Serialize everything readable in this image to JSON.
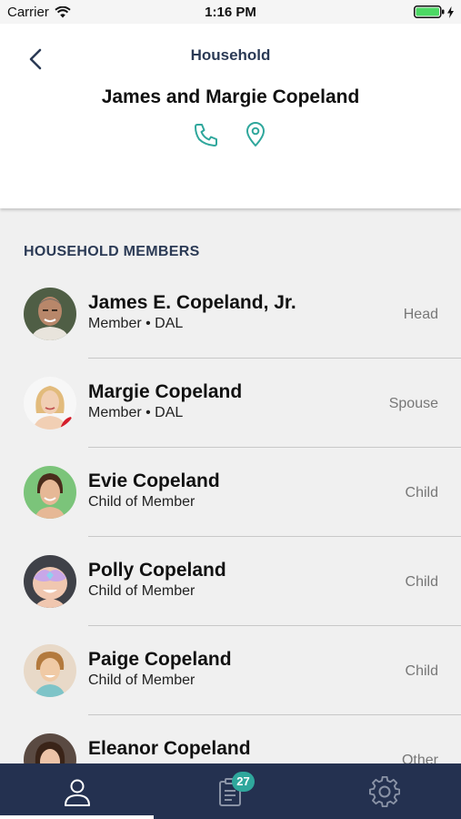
{
  "status_bar": {
    "carrier": "Carrier",
    "time": "1:16 PM"
  },
  "header": {
    "title": "Household",
    "household_name": "James and Margie Copeland"
  },
  "colors": {
    "accent": "#2fa79c",
    "navy": "#243150",
    "title": "#2b3a55"
  },
  "icons": {
    "back": "chevron-left-icon",
    "phone": "phone-icon",
    "location": "map-pin-icon"
  },
  "section": {
    "title": "HOUSEHOLD MEMBERS"
  },
  "members": [
    {
      "name": "James E. Copeland, Jr.",
      "subtitle": "Member • DAL",
      "role": "Head"
    },
    {
      "name": "Margie Copeland",
      "subtitle": "Member • DAL",
      "role": "Spouse"
    },
    {
      "name": "Evie Copeland",
      "subtitle": "Child of Member",
      "role": "Child"
    },
    {
      "name": "Polly Copeland",
      "subtitle": "Child of Member",
      "role": "Child"
    },
    {
      "name": "Paige Copeland",
      "subtitle": "Child of Member",
      "role": "Child"
    },
    {
      "name": "Eleanor Copeland",
      "subtitle": "",
      "role": "Other"
    }
  ],
  "tabs": [
    {
      "icon": "person-icon",
      "active": true
    },
    {
      "icon": "clipboard-icon",
      "badge": "27"
    },
    {
      "icon": "gear-icon"
    }
  ]
}
